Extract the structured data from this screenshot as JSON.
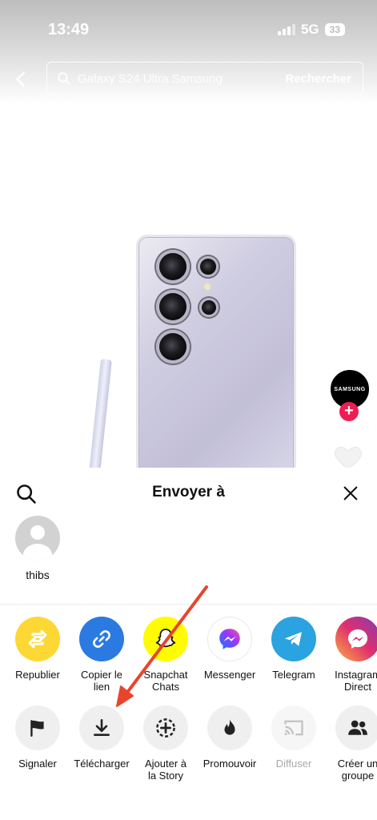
{
  "status_bar": {
    "time": "13:49",
    "network": "5G",
    "battery": "33"
  },
  "top_bar": {
    "search_placeholder": "Galaxy S24 Ultra Samsung",
    "search_action": "Rechercher"
  },
  "video": {
    "brand_avatar_text": "SAMSUNG"
  },
  "share_sheet": {
    "title": "Envoyer à",
    "contacts": [
      {
        "name": "thibs"
      }
    ],
    "share_apps": [
      {
        "label": "Republier",
        "icon": "repost-icon",
        "color": "#fdd835"
      },
      {
        "label": "Copier le lien",
        "icon": "link-icon",
        "color": "#2a7ae2"
      },
      {
        "label": "Snapchat Chats",
        "icon": "snapchat-icon",
        "color": "#fffc00"
      },
      {
        "label": "Messenger",
        "icon": "messenger-icon",
        "color": "#ffffff"
      },
      {
        "label": "Telegram",
        "icon": "telegram-icon",
        "color": "#2aa3e0"
      },
      {
        "label": "Instagram Direct",
        "icon": "instagram-icon",
        "color": "#d62976"
      }
    ],
    "actions": [
      {
        "label": "Signaler",
        "icon": "flag-icon"
      },
      {
        "label": "Télécharger",
        "icon": "download-icon"
      },
      {
        "label": "Ajouter à la Story",
        "icon": "add-story-icon"
      },
      {
        "label": "Promouvoir",
        "icon": "flame-icon"
      },
      {
        "label": "Diffuser",
        "icon": "cast-icon",
        "disabled": true
      },
      {
        "label": "Créer un groupe",
        "icon": "group-icon"
      }
    ]
  },
  "annotation": {
    "arrow_color": "#e8452c"
  }
}
